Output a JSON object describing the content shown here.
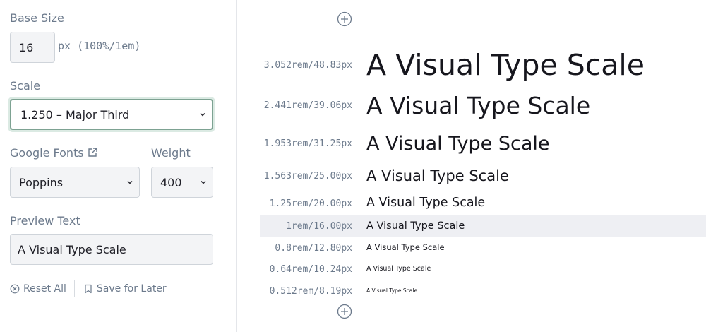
{
  "controls": {
    "base_size": {
      "label": "Base Size",
      "value": "16",
      "unit": "px (100%/1em)"
    },
    "scale": {
      "label": "Scale",
      "selected": "1.250 – Major Third"
    },
    "font": {
      "label": "Google Fonts",
      "selected": "Poppins"
    },
    "weight": {
      "label": "Weight",
      "selected": "400"
    },
    "preview_text": {
      "label": "Preview Text",
      "value": "A Visual Type Scale"
    },
    "actions": {
      "reset_label": "Reset All",
      "save_label": "Save for Later"
    }
  },
  "preview": {
    "sample_text": "A Visual Type Scale",
    "rows": [
      {
        "size": "3.052rem/48.83px"
      },
      {
        "size": "2.441rem/39.06px"
      },
      {
        "size": "1.953rem/31.25px"
      },
      {
        "size": "1.563rem/25.00px"
      },
      {
        "size": "1.25rem/20.00px"
      },
      {
        "size": "1rem/16.00px"
      },
      {
        "size": "0.8rem/12.80px"
      },
      {
        "size": "0.64rem/10.24px"
      },
      {
        "size": "0.512rem/8.19px"
      }
    ]
  },
  "icons": {
    "add": "plus-circle-icon",
    "external": "external-link-icon",
    "reset": "x-circle-icon",
    "save": "bookmark-icon",
    "dropdown": "chevron-down-icon"
  },
  "colors": {
    "label": "#6c7a8c",
    "focus_border": "#7da292",
    "highlight_row": "#eeeff3"
  }
}
